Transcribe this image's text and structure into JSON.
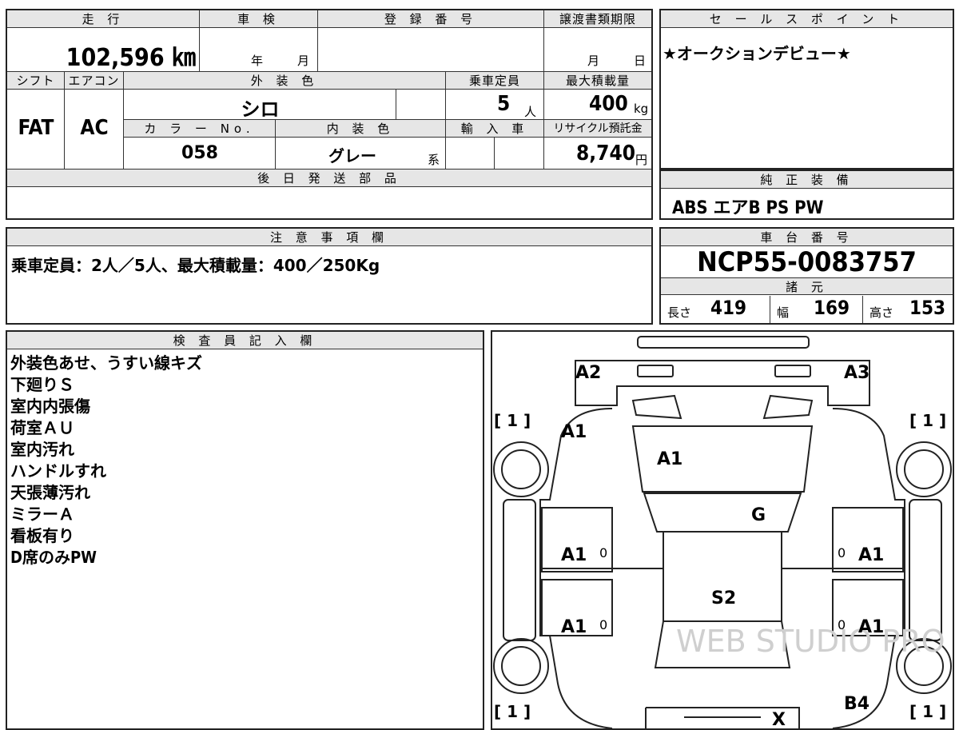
{
  "top": {
    "mileage_header": "走 行",
    "mileage_value": "102,596 ㎞",
    "shaken_header": "車 検",
    "shaken_year_unit": "年",
    "shaken_month_unit": "月",
    "reg_header": "登 録 番 号",
    "transfer_header": "譲渡書類期限",
    "transfer_month_unit": "月",
    "transfer_day_unit": "日"
  },
  "specs": {
    "shift_header": "シフト",
    "shift_value": "FAT",
    "ac_header": "エアコン",
    "ac_value": "AC",
    "ext_color_header": "外 装 色",
    "ext_color_value": "シロ",
    "capacity_header": "乗車定員",
    "capacity_value": "5",
    "capacity_unit": "人",
    "maxload_header": "最大積載量",
    "maxload_value": "400",
    "maxload_unit": "kg",
    "color_no_header": "カ ラ ー No.",
    "color_no_value": "058",
    "int_color_header": "内 装 色",
    "int_color_value": "グレー",
    "int_color_unit": "系",
    "import_header": "輸 入 車",
    "recycle_header": "リサイクル預託金",
    "recycle_value": "8,740",
    "recycle_unit": "円",
    "later_parts_header": "後 日 発 送 部 品"
  },
  "sales": {
    "header": "セ ー ル ス ポ イ ン ト",
    "text": "★オークションデビュー★"
  },
  "equipment": {
    "header": "純 正 装 備",
    "text": "ABS エアB PS PW"
  },
  "notes": {
    "header": "注 意 事 項 欄",
    "text": "乗車定員：2人／5人、最大積載量：400／250Kg"
  },
  "chassis": {
    "header": "車 台 番 号",
    "value": "NCP55-0083757",
    "dims_header": "諸 元",
    "length_label": "長さ",
    "length_value": "419",
    "width_label": "幅",
    "width_value": "169",
    "height_label": "高さ",
    "height_value": "153"
  },
  "inspector": {
    "header": "検 査 員 記 入 欄",
    "lines": [
      "外装色あせ、うすい線キズ",
      "下廻りＳ",
      "室内内張傷",
      "荷室ＡＵ",
      "室内汚れ",
      "ハンドルすれ",
      "天張薄汚れ",
      "ミラーＡ",
      "看板有り",
      "D席のみPW"
    ]
  },
  "diagram": {
    "marks": {
      "front_left_corner": "A2",
      "front_right_corner": "A3",
      "front_left_fender": "A1",
      "hood": "A1",
      "windshield": "G",
      "front_left_door": "A1",
      "front_right_door": "A1",
      "roof": "S2",
      "rear_left_door": "A1",
      "rear_right_door": "A1",
      "rear_right_quarter": "B4",
      "rear_center": "X"
    },
    "tire_labels": {
      "front_left": "[ 1 ]",
      "front_right": "[ 1 ]",
      "rear_left": "[ 1 ]",
      "rear_right": "[ 1 ]"
    },
    "door_markers": [
      "0",
      "0",
      "0",
      "0"
    ],
    "watermark": "WEB STUDIO PRO"
  }
}
